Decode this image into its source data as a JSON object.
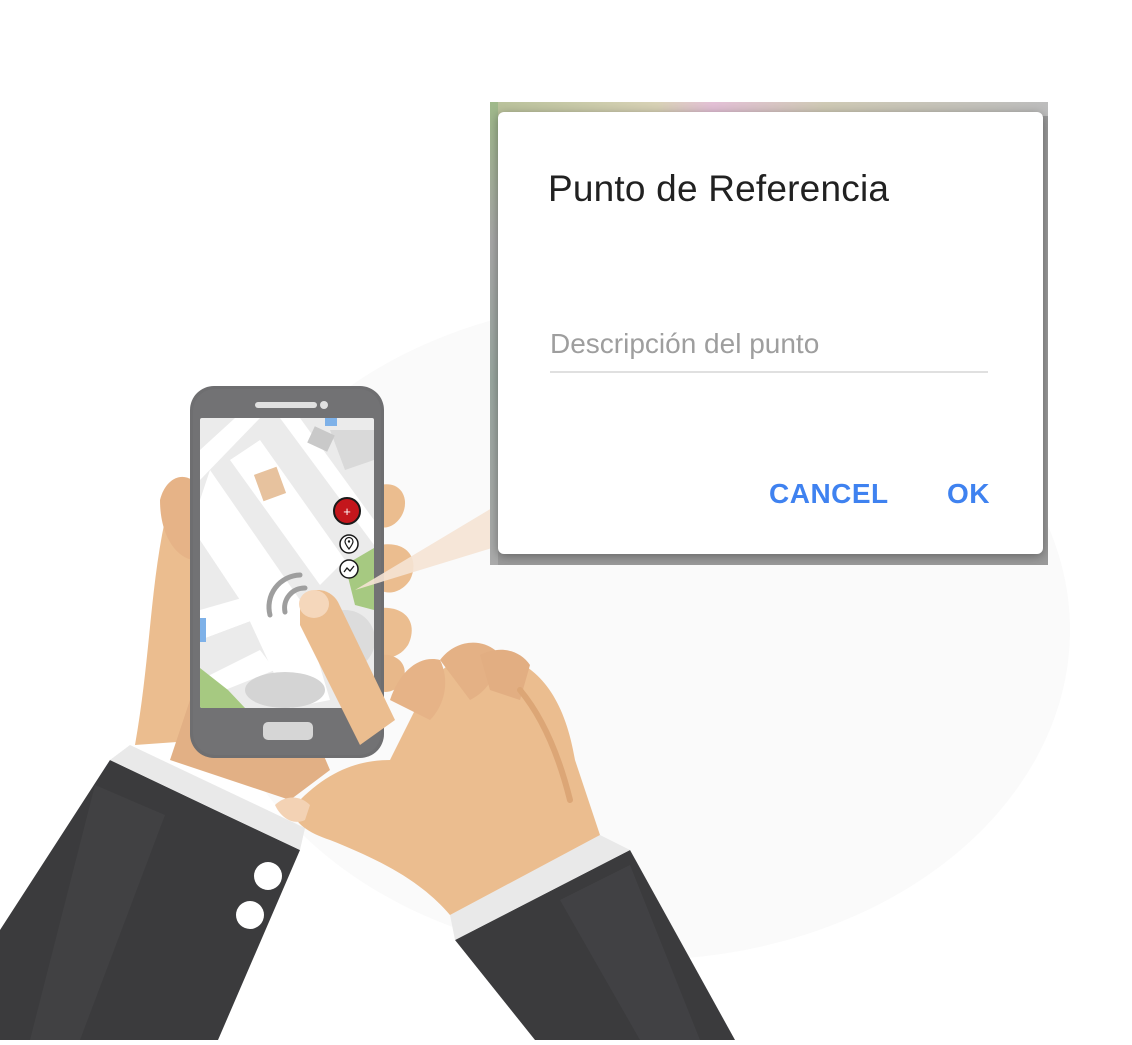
{
  "dialog": {
    "title": "Punto de Referencia",
    "input_placeholder": "Descripción del punto",
    "input_value": "",
    "cancel_label": "CANCEL",
    "ok_label": "OK"
  },
  "phone_map_controls": {
    "add_glyph": "+"
  },
  "colors": {
    "accent_blue": "#3f82f0",
    "add_button_red": "#c4161c",
    "suit": "#3b3b3d",
    "skin": "#ebbd8f",
    "phone_body": "#6e6e70"
  }
}
